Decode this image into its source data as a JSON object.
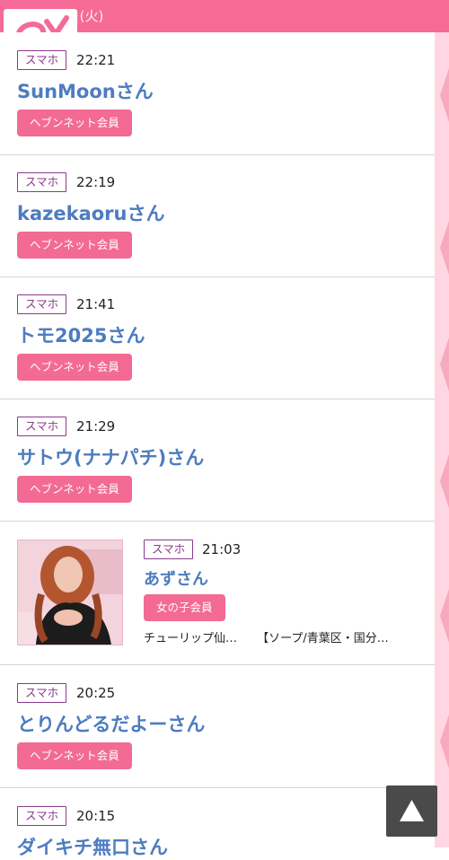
{
  "header": {
    "date": "10月7日(火)"
  },
  "entries": [
    {
      "device": "スマホ",
      "time": "22:21",
      "name": "SunMoonさん",
      "member": "ヘブンネット会員"
    },
    {
      "device": "スマホ",
      "time": "22:19",
      "name": "kazekaoruさん",
      "member": "ヘブンネット会員"
    },
    {
      "device": "スマホ",
      "time": "21:41",
      "name": "トモ2025さん",
      "member": "ヘブンネット会員"
    },
    {
      "device": "スマホ",
      "time": "21:29",
      "name": "サトウ(ナナパチ)さん",
      "member": "ヘブンネット会員"
    },
    {
      "device": "スマホ",
      "time": "21:03",
      "name": "あずさん",
      "member": "女の子会員",
      "shop": "チューリップ仙…",
      "area": "【ソープ/青葉区・国分…"
    },
    {
      "device": "スマホ",
      "time": "20:25",
      "name": "とりんどるだよーさん",
      "member": "ヘブンネット会員"
    },
    {
      "device": "スマホ",
      "time": "20:15",
      "name": "ダイキチ無口さん"
    }
  ],
  "colors": {
    "accent": "#f56a96",
    "badge": "#8a3a8e",
    "name": "#4d7cc0",
    "member_button": "#f36a95"
  },
  "icons": {
    "scroll_top": "triangle-up-icon",
    "logo": "logo-mark"
  }
}
